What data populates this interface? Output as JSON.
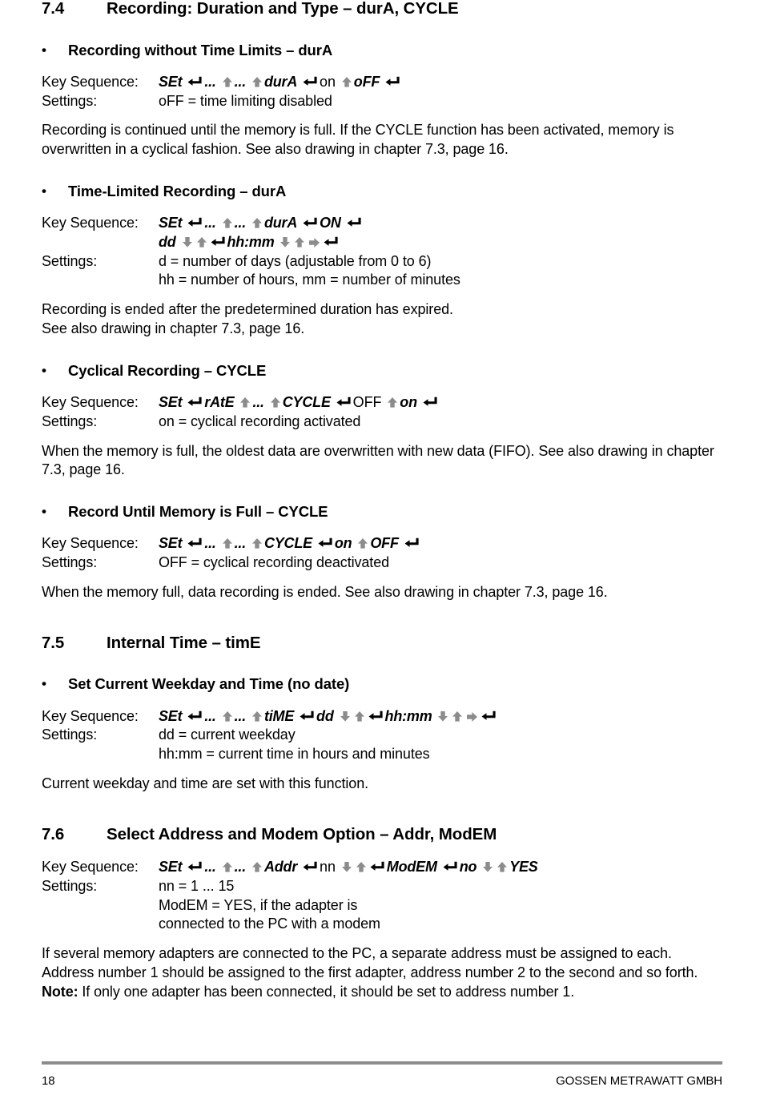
{
  "footer": {
    "page_number": "18",
    "company": "GOSSEN METRAWATT GMBH",
    "rule_color": "#8c8c8c"
  },
  "icons": {
    "enter": "enter-return-arrow-icon",
    "up": "up-arrow-icon",
    "down": "down-arrow-icon",
    "right": "right-arrow-icon",
    "enter_color": "#000000",
    "arrow_color": "#8c8c8c"
  },
  "labels": {
    "key_sequence": "Key Sequence:",
    "settings": "Settings:",
    "bullet": "•"
  },
  "sections": [
    {
      "id": "7.4",
      "number": "7.4",
      "title": "Recording: Duration and Type – durA, CYCLE",
      "subsections": [
        {
          "id": "dura-no-limit",
          "title": "Recording without Time Limits – durA",
          "key_sequence_lines": [
            [
              {
                "t": "SEt",
                "s": "bi"
              },
              {
                "i": "enter"
              },
              {
                "t": "...",
                "s": "bi"
              },
              {
                "i": "up"
              },
              {
                "t": "...",
                "s": "bi"
              },
              {
                "i": "up"
              },
              {
                "t": "durA",
                "s": "bi"
              },
              {
                "i": "enter"
              },
              {
                "t": "on",
                "s": "n"
              },
              {
                "i": "up"
              },
              {
                "t": "oFF",
                "s": "bi"
              },
              {
                "i": "enter"
              }
            ]
          ],
          "settings_lines": [
            "oFF = time limiting disabled"
          ],
          "paragraphs": [
            "Recording is continued until the memory is full. If the CYCLE function has been activated, memory is overwritten in a cyclical fashion. See also drawing in chapter 7.3, page 16."
          ]
        },
        {
          "id": "dura-time-limited",
          "title": "Time-Limited Recording – durA",
          "key_sequence_lines": [
            [
              {
                "t": "SEt",
                "s": "bi"
              },
              {
                "i": "enter"
              },
              {
                "t": "...",
                "s": "bi"
              },
              {
                "i": "up"
              },
              {
                "t": "...",
                "s": "bi"
              },
              {
                "i": "up"
              },
              {
                "t": "durA",
                "s": "bi"
              },
              {
                "i": "enter"
              },
              {
                "t": "ON",
                "s": "bi"
              },
              {
                "i": "enter"
              }
            ],
            [
              {
                "t": "dd",
                "s": "bi"
              },
              {
                "i": "down"
              },
              {
                "i": "up"
              },
              {
                "i": "enter"
              },
              {
                "t": "hh:mm",
                "s": "bi"
              },
              {
                "i": "down"
              },
              {
                "i": "up"
              },
              {
                "i": "right"
              },
              {
                "i": "enter"
              }
            ]
          ],
          "settings_lines": [
            "d = number of days (adjustable from 0 to 6)",
            "hh = number of hours, mm = number of minutes"
          ],
          "paragraphs": [
            "Recording is ended after the predetermined duration has expired.\nSee also drawing in chapter 7.3, page 16."
          ]
        },
        {
          "id": "cycle-cyclical",
          "title": "Cyclical Recording – CYCLE",
          "key_sequence_lines": [
            [
              {
                "t": "SEt",
                "s": "bi"
              },
              {
                "i": "enter"
              },
              {
                "t": "rAtE",
                "s": "bi"
              },
              {
                "i": "up"
              },
              {
                "t": "...",
                "s": "bi"
              },
              {
                "i": "up"
              },
              {
                "t": "CYCLE",
                "s": "bi"
              },
              {
                "i": "enter"
              },
              {
                "t": "OFF",
                "s": "n"
              },
              {
                "i": "up"
              },
              {
                "t": "on",
                "s": "bi"
              },
              {
                "i": "enter"
              }
            ]
          ],
          "settings_lines": [
            "on = cyclical recording activated"
          ],
          "paragraphs": [
            "When the memory is full, the oldest data are overwritten with new data (FIFO). See also drawing in chapter 7.3, page 16."
          ]
        },
        {
          "id": "cycle-until-full",
          "title": "Record Until Memory is Full – CYCLE",
          "key_sequence_lines": [
            [
              {
                "t": "SEt",
                "s": "bi"
              },
              {
                "i": "enter"
              },
              {
                "t": "...",
                "s": "bi"
              },
              {
                "i": "up"
              },
              {
                "t": "...",
                "s": "bi"
              },
              {
                "i": "up"
              },
              {
                "t": "CYCLE",
                "s": "bi"
              },
              {
                "i": "enter"
              },
              {
                "t": "on",
                "s": "bi"
              },
              {
                "i": "up"
              },
              {
                "t": "OFF",
                "s": "bi"
              },
              {
                "i": "enter"
              }
            ]
          ],
          "settings_lines": [
            "OFF = cyclical recording deactivated"
          ],
          "paragraphs": [
            "When the memory full, data recording is ended. See also drawing in chapter 7.3, page 16."
          ]
        }
      ]
    },
    {
      "id": "7.5",
      "number": "7.5",
      "title": "Internal Time – timE",
      "subsections": [
        {
          "id": "set-weekday-time",
          "title": "Set Current Weekday and Time (no date)",
          "key_sequence_lines": [
            [
              {
                "t": "SEt",
                "s": "bi"
              },
              {
                "i": "enter"
              },
              {
                "t": "...",
                "s": "bi"
              },
              {
                "i": "up"
              },
              {
                "t": "...",
                "s": "bi"
              },
              {
                "i": "up"
              },
              {
                "t": "tiME",
                "s": "bi"
              },
              {
                "i": "enter"
              },
              {
                "t": "dd",
                "s": "bi"
              },
              {
                "i": "down"
              },
              {
                "i": "up"
              },
              {
                "i": "enter"
              },
              {
                "t": "hh:mm",
                "s": "bi"
              },
              {
                "i": "down"
              },
              {
                "i": "up"
              },
              {
                "i": "right"
              },
              {
                "i": "enter"
              }
            ]
          ],
          "settings_lines": [
            "dd = current weekday",
            "hh:mm = current time in hours and minutes"
          ],
          "paragraphs": [
            "Current weekday and time are set with this function."
          ]
        }
      ]
    },
    {
      "id": "7.6",
      "number": "7.6",
      "title": "Select Address and Modem Option – Addr, ModEM",
      "subsections": [
        {
          "id": "select-address-modem",
          "title": "",
          "key_sequence_lines": [
            [
              {
                "t": "SEt",
                "s": "bi"
              },
              {
                "i": "enter"
              },
              {
                "t": "...",
                "s": "bi"
              },
              {
                "i": "up"
              },
              {
                "t": "...",
                "s": "bi"
              },
              {
                "i": "up"
              },
              {
                "t": "Addr",
                "s": "bi"
              },
              {
                "i": "enter"
              },
              {
                "t": "nn",
                "s": "n"
              },
              {
                "i": "down"
              },
              {
                "i": "up"
              },
              {
                "i": "enter"
              },
              {
                "t": "ModEM",
                "s": "bi"
              },
              {
                "i": "enter"
              },
              {
                "t": "no",
                "s": "bi"
              },
              {
                "i": "down"
              },
              {
                "i": "up"
              },
              {
                "t": "YES",
                "s": "bi"
              }
            ]
          ],
          "settings_lines": [
            "nn = 1 ... 15",
            "ModEM = YES, if the adapter is",
            "connected to the PC with a modem"
          ],
          "paragraphs": [
            "If several memory adapters are connected to the PC, a separate address must be assigned to each. Address number 1 should be assigned to the first adapter, address number 2 to the second and so forth."
          ],
          "note": {
            "label": "Note:",
            "text": " If only one adapter has been connected, it should be set to address number 1."
          }
        }
      ]
    }
  ]
}
